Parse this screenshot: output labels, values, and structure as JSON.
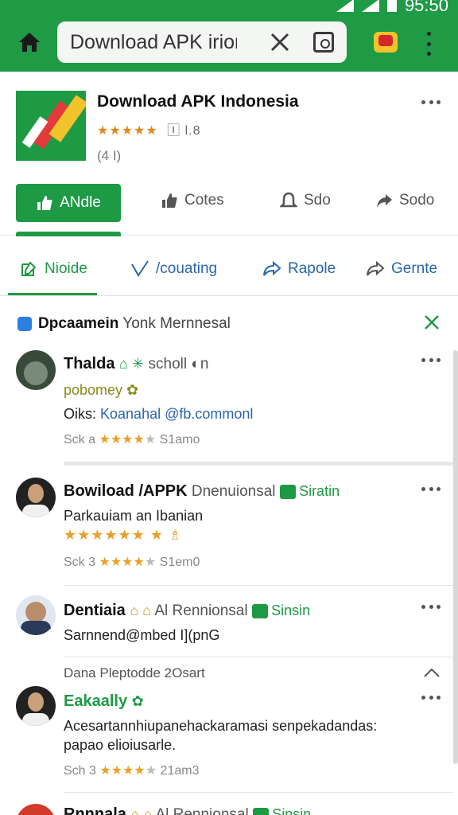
{
  "status": {
    "time": "95:50"
  },
  "toolbar": {
    "url_text": "Download APK irion"
  },
  "app": {
    "title": "Download APK Indonesia",
    "stars": "★★★★★",
    "rating_extra": "🄸 l.8",
    "sub": "(4 I)",
    "install_label": "ANdle",
    "actions": [
      "Cotes",
      "Sdo",
      "Sodo"
    ]
  },
  "tabs": [
    {
      "label": "Nioide"
    },
    {
      "label": "/couating"
    },
    {
      "label": "Rapole"
    },
    {
      "label": "Gernte"
    }
  ],
  "banner": {
    "bold": "Dpcaamein",
    "text": " Yonk Mernnesal"
  },
  "posts": [
    {
      "name": "Thalda",
      "badge": "⌂ ✳",
      "tail": "scholl ◐n",
      "line1": "pobomey ✿",
      "line2_prefix": "Oiks: ",
      "line2_link": "Koanahal @fb.commonl",
      "stars_prefix": "Sck a",
      "stars_on": "★★★★",
      "stars_off": "★",
      "stars_suffix": "S1amo"
    },
    {
      "name": "Bowiload /APPK",
      "tail": " Dnenuionsal",
      "badge": "Siratin",
      "line1": "Parkauiam an Ibanian",
      "big_stars": "★★★★★★ ★ ♗",
      "stars_prefix": "Sck 3",
      "stars_on": "★★★★",
      "stars_off": "★",
      "stars_suffix": "S1em0"
    },
    {
      "name": "Dentiaia",
      "badge": "⌂ ⌂",
      "tail": " Al Rennionsal",
      "badge2": "Sinsin",
      "line1": "Sarnnend@mbed I](pnG"
    },
    {
      "group_head": "Dana Pleptodde  2Osart",
      "name": "Eakaally",
      "badge": "✿",
      "line1": "Acesartannhiupanehackaramasi senpekadandas:",
      "line2": "papao elioiusarle.",
      "stars_prefix": "Sch 3",
      "stars_on": "★★★★",
      "stars_off": "★",
      "stars_suffix": "21am3"
    },
    {
      "name": "Rnnnala",
      "badge": "⌂ ⌂",
      "tail": " Al Rennionsal",
      "badge2": "Sinsin"
    }
  ]
}
